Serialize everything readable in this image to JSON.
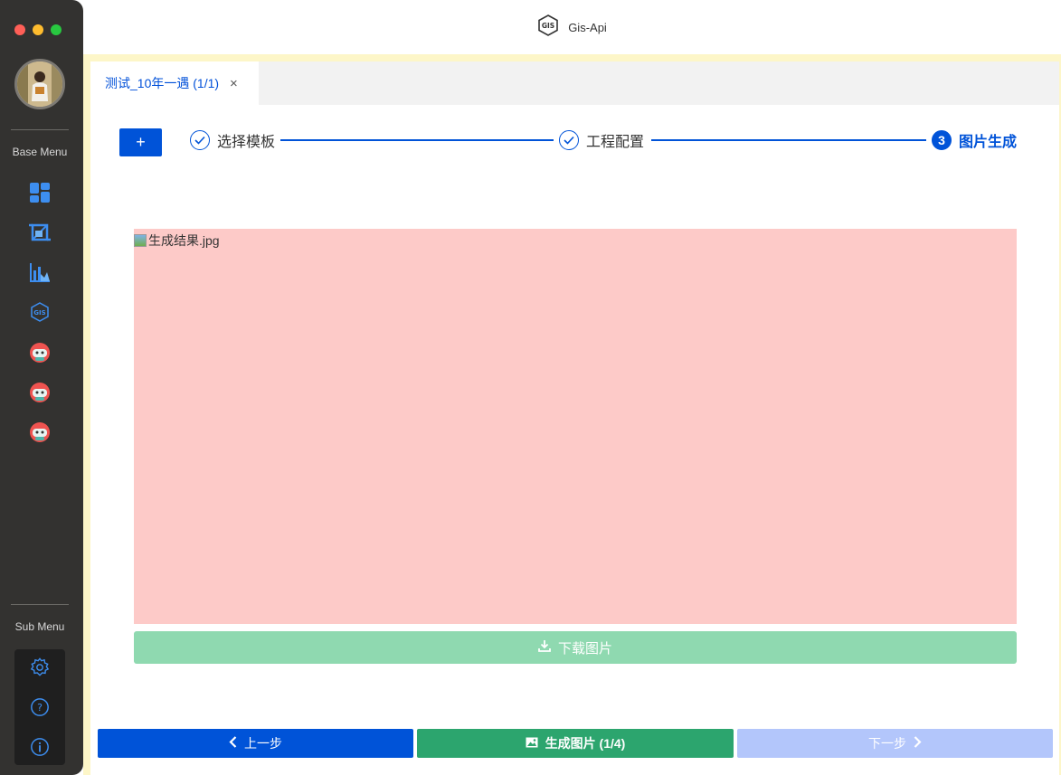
{
  "window": {
    "app_title": "Gis-Api"
  },
  "sidebar": {
    "base_menu_label": "Base Menu",
    "sub_menu_label": "Sub Menu",
    "items": [
      {
        "icon": "dashboard-icon"
      },
      {
        "icon": "crop-icon"
      },
      {
        "icon": "chart-icon"
      },
      {
        "icon": "gis-icon"
      },
      {
        "icon": "robot-icon"
      },
      {
        "icon": "robot-icon"
      },
      {
        "icon": "robot-icon"
      }
    ],
    "sub_items": [
      {
        "icon": "gear-icon"
      },
      {
        "icon": "help-icon"
      },
      {
        "icon": "info-icon"
      }
    ]
  },
  "tabs": [
    {
      "label": "测试_10年一遇 (1/1)",
      "close": "×"
    }
  ],
  "toolbar": {
    "add_label": "+"
  },
  "steps": [
    {
      "label": "选择模板",
      "status": "done"
    },
    {
      "label": "工程配置",
      "status": "done"
    },
    {
      "number": "3",
      "label": "图片生成",
      "status": "active"
    }
  ],
  "result": {
    "image_alt": "生成结果.jpg"
  },
  "buttons": {
    "download": "下载图片",
    "prev": "上一步",
    "generate": "生成图片 (1/4)",
    "next": "下一步"
  },
  "colors": {
    "primary": "#0053d8",
    "success": "#2ca56e",
    "sidebar_bg": "#333230",
    "frame_bg": "#fdf6c8",
    "image_placeholder": "#fdcac8"
  }
}
